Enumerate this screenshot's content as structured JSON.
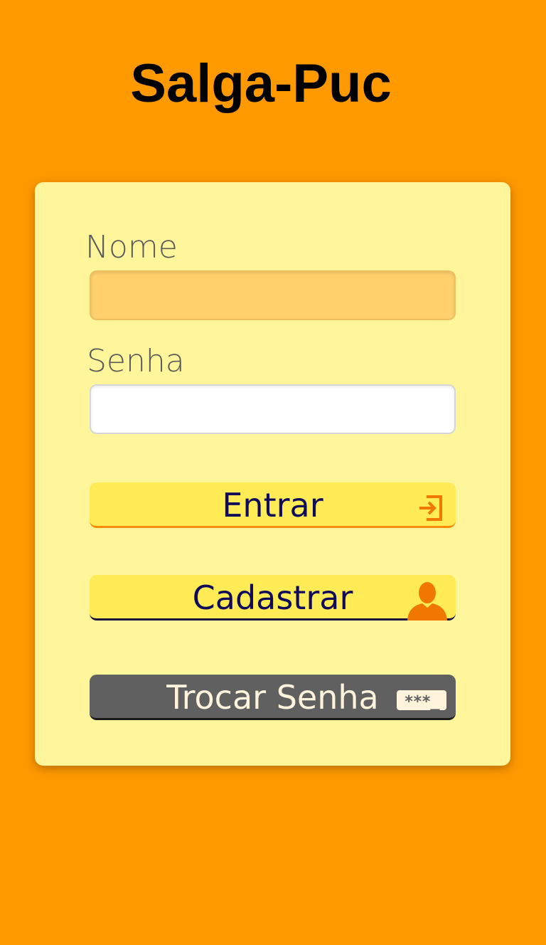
{
  "app": {
    "title": "Salga-Puc"
  },
  "form": {
    "nome": {
      "label": "Nome",
      "value": "",
      "placeholder": ""
    },
    "senha": {
      "label": "Senha",
      "value": "",
      "placeholder": ""
    }
  },
  "buttons": {
    "entrar": {
      "label": "Entrar",
      "icon": "login-icon"
    },
    "cadastrar": {
      "label": "Cadastrar",
      "icon": "user-icon"
    },
    "trocar_senha": {
      "label": "Trocar Senha",
      "icon": "password-icon",
      "icon_text": "***_"
    }
  },
  "colors": {
    "background": "#ff9900",
    "card": "#fff59a",
    "button_yellow": "#ffeb55",
    "button_dark": "#606060",
    "button_text": "#100a5a",
    "icon_orange": "#f07800",
    "nome_field": "#ffd06b"
  }
}
